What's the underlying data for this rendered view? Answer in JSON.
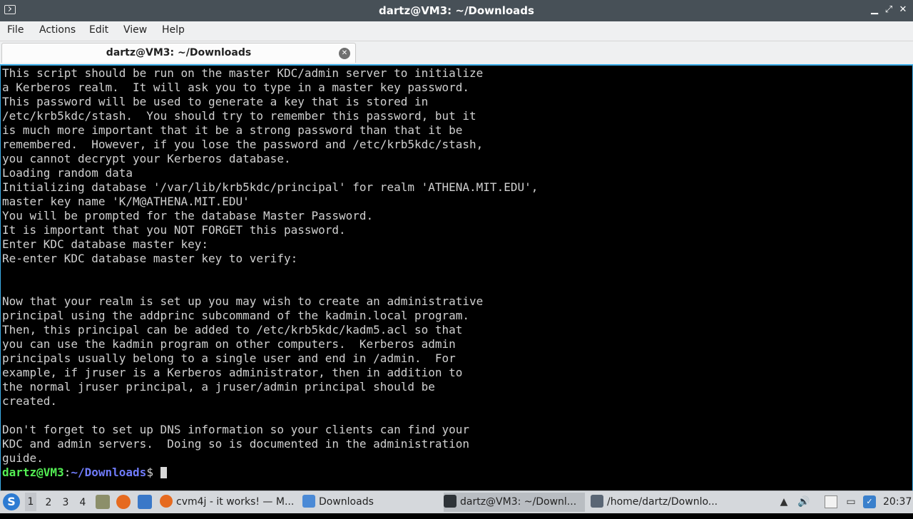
{
  "window": {
    "title": "dartz@VM3: ~/Downloads",
    "minimize": "▁",
    "restore": "⤢",
    "close": "✕"
  },
  "menu": [
    "File",
    "Actions",
    "Edit",
    "View",
    "Help"
  ],
  "tab": {
    "label": "dartz@VM3: ~/Downloads",
    "close": "✕"
  },
  "terminal": {
    "lines": [
      "This script should be run on the master KDC/admin server to initialize",
      "a Kerberos realm.  It will ask you to type in a master key password.",
      "This password will be used to generate a key that is stored in",
      "/etc/krb5kdc/stash.  You should try to remember this password, but it",
      "is much more important that it be a strong password than that it be",
      "remembered.  However, if you lose the password and /etc/krb5kdc/stash,",
      "you cannot decrypt your Kerberos database.",
      "Loading random data",
      "Initializing database '/var/lib/krb5kdc/principal' for realm 'ATHENA.MIT.EDU',",
      "master key name 'K/M@ATHENA.MIT.EDU'",
      "You will be prompted for the database Master Password.",
      "It is important that you NOT FORGET this password.",
      "Enter KDC database master key:",
      "Re-enter KDC database master key to verify:",
      "",
      "",
      "Now that your realm is set up you may wish to create an administrative",
      "principal using the addprinc subcommand of the kadmin.local program.",
      "Then, this principal can be added to /etc/krb5kdc/kadm5.acl so that",
      "you can use the kadmin program on other computers.  Kerberos admin",
      "principals usually belong to a single user and end in /admin.  For",
      "example, if jruser is a Kerberos administrator, then in addition to",
      "the normal jruser principal, a jruser/admin principal should be",
      "created.",
      "",
      "Don't forget to set up DNS information so your clients can find your",
      "KDC and admin servers.  Doing so is documented in the administration",
      "guide."
    ],
    "prompt": {
      "user": "dartz@VM3",
      "sep": ":",
      "path": "~/Downloads",
      "symbol": "$ "
    }
  },
  "taskbar": {
    "start_icon": "start-menu-icon",
    "workspaces": [
      "1",
      "2",
      "3",
      "4"
    ],
    "active_workspace": "1",
    "quicklaunch": [
      "file-manager-icon",
      "firefox-icon",
      "desktop-icon"
    ],
    "tasks": [
      {
        "label": "cvm4j - it works! — M...",
        "icon": "firefox-icon"
      },
      {
        "label": "Downloads",
        "icon": "folder-icon"
      },
      {
        "label": "dartz@VM3: ~/Downl...",
        "icon": "terminal-icon",
        "active": true
      },
      {
        "label": "/home/dartz/Downlo...",
        "icon": "text-editor-icon"
      }
    ],
    "tray_icons": [
      "tray-up-icon",
      "volume-icon",
      "clipboard-icon",
      "monitor-icon",
      "updates-icon"
    ],
    "clock": "20:37"
  },
  "colors": {
    "titlebar": "#475057",
    "terminal_bg": "#000000",
    "terminal_fg": "#d0d0d0",
    "prompt_user": "#54f054",
    "prompt_path": "#6f7bf9",
    "focus_border": "#3daee9"
  }
}
